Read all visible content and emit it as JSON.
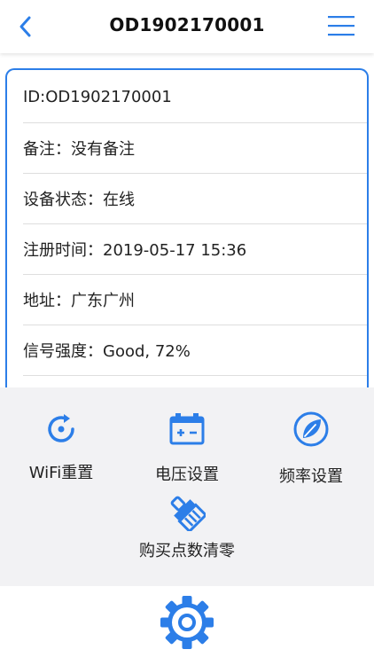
{
  "header": {
    "title": "OD1902170001",
    "back_icon": "chevron-left-icon",
    "menu_icon": "hamburger-menu-icon"
  },
  "info": {
    "rows": [
      {
        "text": "ID:OD1902170001"
      },
      {
        "text": "备注：没有备注"
      },
      {
        "text": "设备状态：在线"
      },
      {
        "text": "注册时间：2019-05-17 15:36"
      },
      {
        "text": "地址：广东广州"
      },
      {
        "text": "信号强度：Good, 72%"
      }
    ]
  },
  "actions": [
    {
      "label": "WiFi重置",
      "icon": "wifi-reset-icon"
    },
    {
      "label": "电压设置",
      "icon": "battery-icon"
    },
    {
      "label": "频率设置",
      "icon": "leaf-icon"
    },
    {
      "label": "购买点数清零",
      "icon": "broom-icon"
    }
  ],
  "footer": {
    "icon": "gear-icon"
  },
  "colors": {
    "accent": "#2c7ee8",
    "panel_bg": "#f2f2f4",
    "text": "#222222"
  }
}
